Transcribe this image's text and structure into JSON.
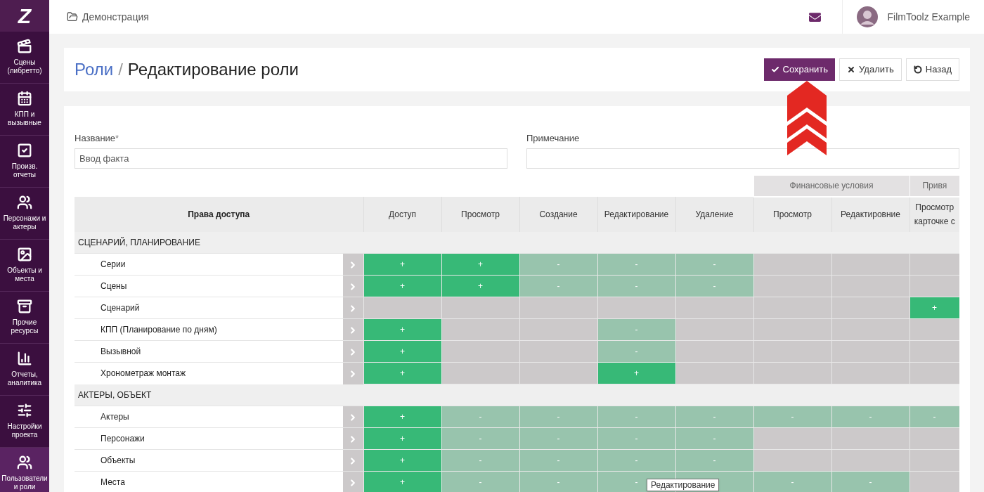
{
  "sidebar": {
    "logo": "Z",
    "items": [
      {
        "label": "Сцены (либретто)",
        "selected": false
      },
      {
        "label": "КПП и вызывные",
        "selected": false
      },
      {
        "label": "Произв. отчеты",
        "selected": false
      },
      {
        "label": "Персонажи и актеры",
        "selected": false
      },
      {
        "label": "Объекты и места",
        "selected": false
      },
      {
        "label": "Прочие ресурсы",
        "selected": false
      },
      {
        "label": "Отчеты, аналитика",
        "selected": false
      },
      {
        "label": "Настройки проекта",
        "selected": false
      },
      {
        "label": "Пользователи и роли",
        "selected": true
      }
    ]
  },
  "topbar": {
    "project": "Демонстрация",
    "user": "FilmToolz Example"
  },
  "header": {
    "breadcrumb": "Роли",
    "separator": "/",
    "title": "Редактирование роли",
    "buttons": [
      {
        "kind": "primary",
        "label": "Сохранить"
      },
      {
        "kind": "default",
        "label": "Удалить"
      },
      {
        "kind": "default",
        "label": "Назад"
      }
    ]
  },
  "form": {
    "fields": [
      {
        "label": "Название",
        "required_mark": "*",
        "value": "Ввод факта"
      },
      {
        "label": "Примечание"
      }
    ]
  },
  "table": {
    "groups": [
      {
        "label": "Финансовые условия"
      },
      {
        "label": "Привя"
      }
    ],
    "first_column": "Права доступа",
    "columns": [
      [
        "Доступ"
      ],
      [
        "Просмотр"
      ],
      [
        "Создание"
      ],
      [
        "Редактирование"
      ],
      [
        "Удаление"
      ],
      [
        "Просмотр"
      ],
      [
        "Редактировние"
      ],
      [
        "Просмотр",
        "карточке с"
      ]
    ],
    "sections": [
      {
        "title": "СЦЕНАРИЙ, ПЛАНИРОВАНИЕ",
        "rows": [
          {
            "name": "Серии",
            "cells": [
              {
                "kind": "granted",
                "text": "+"
              },
              {
                "kind": "granted",
                "text": "+"
              },
              {
                "kind": "denied",
                "text": "-"
              },
              {
                "kind": "denied",
                "text": "-"
              },
              {
                "kind": "denied",
                "text": "-"
              },
              {
                "kind": "none"
              },
              {
                "kind": "none"
              },
              {
                "kind": "none"
              }
            ]
          },
          {
            "name": "Сцены",
            "cells": [
              {
                "kind": "granted",
                "text": "+"
              },
              {
                "kind": "granted",
                "text": "+"
              },
              {
                "kind": "denied",
                "text": "-"
              },
              {
                "kind": "denied",
                "text": "-"
              },
              {
                "kind": "denied",
                "text": "-"
              },
              {
                "kind": "none"
              },
              {
                "kind": "none"
              },
              {
                "kind": "none"
              }
            ]
          },
          {
            "name": "Сценарий",
            "cells": [
              {
                "kind": "none"
              },
              {
                "kind": "none"
              },
              {
                "kind": "none"
              },
              {
                "kind": "none"
              },
              {
                "kind": "none"
              },
              {
                "kind": "none"
              },
              {
                "kind": "none"
              },
              {
                "kind": "granted",
                "text": "+"
              }
            ]
          },
          {
            "name": "КПП (Планирование по дням)",
            "cells": [
              {
                "kind": "granted",
                "text": "+"
              },
              {
                "kind": "none"
              },
              {
                "kind": "none"
              },
              {
                "kind": "denied",
                "text": "-"
              },
              {
                "kind": "none"
              },
              {
                "kind": "none"
              },
              {
                "kind": "none"
              },
              {
                "kind": "none"
              }
            ]
          },
          {
            "name": "Вызывной",
            "cells": [
              {
                "kind": "granted",
                "text": "+"
              },
              {
                "kind": "none"
              },
              {
                "kind": "none"
              },
              {
                "kind": "denied",
                "text": "-"
              },
              {
                "kind": "none"
              },
              {
                "kind": "none"
              },
              {
                "kind": "none"
              },
              {
                "kind": "none"
              }
            ]
          },
          {
            "name": "Хронометраж монтаж",
            "cells": [
              {
                "kind": "granted",
                "text": "+"
              },
              {
                "kind": "none"
              },
              {
                "kind": "none"
              },
              {
                "kind": "granted",
                "text": "+"
              },
              {
                "kind": "none"
              },
              {
                "kind": "none"
              },
              {
                "kind": "none"
              },
              {
                "kind": "none"
              }
            ]
          }
        ]
      },
      {
        "title": "АКТЕРЫ, ОБЪЕКТ",
        "rows": [
          {
            "name": "Актеры",
            "cells": [
              {
                "kind": "granted",
                "text": "+"
              },
              {
                "kind": "denied",
                "text": "-"
              },
              {
                "kind": "denied",
                "text": "-"
              },
              {
                "kind": "denied",
                "text": "-"
              },
              {
                "kind": "denied",
                "text": "-"
              },
              {
                "kind": "denied",
                "text": "-"
              },
              {
                "kind": "denied",
                "text": "-"
              },
              {
                "kind": "denied",
                "text": "-"
              }
            ]
          },
          {
            "name": "Персонажи",
            "cells": [
              {
                "kind": "granted",
                "text": "+"
              },
              {
                "kind": "denied",
                "text": "-"
              },
              {
                "kind": "denied",
                "text": "-"
              },
              {
                "kind": "denied",
                "text": "-"
              },
              {
                "kind": "denied",
                "text": "-"
              },
              {
                "kind": "none"
              },
              {
                "kind": "none"
              },
              {
                "kind": "none"
              }
            ]
          },
          {
            "name": "Объекты",
            "cells": [
              {
                "kind": "granted",
                "text": "+"
              },
              {
                "kind": "denied",
                "text": "-"
              },
              {
                "kind": "denied",
                "text": "-"
              },
              {
                "kind": "denied",
                "text": "-"
              },
              {
                "kind": "denied",
                "text": "-"
              },
              {
                "kind": "none"
              },
              {
                "kind": "none"
              },
              {
                "kind": "none"
              }
            ]
          },
          {
            "name": "Места",
            "cells": [
              {
                "kind": "granted",
                "text": "+"
              },
              {
                "kind": "denied",
                "text": "-"
              },
              {
                "kind": "denied",
                "text": "-"
              },
              {
                "kind": "denied",
                "text": "-"
              },
              {
                "kind": "denied"
              },
              {
                "kind": "denied",
                "text": "-"
              },
              {
                "kind": "denied",
                "text": "-"
              },
              {
                "kind": "none"
              }
            ]
          }
        ]
      }
    ]
  },
  "tooltip": "Редактирование"
}
